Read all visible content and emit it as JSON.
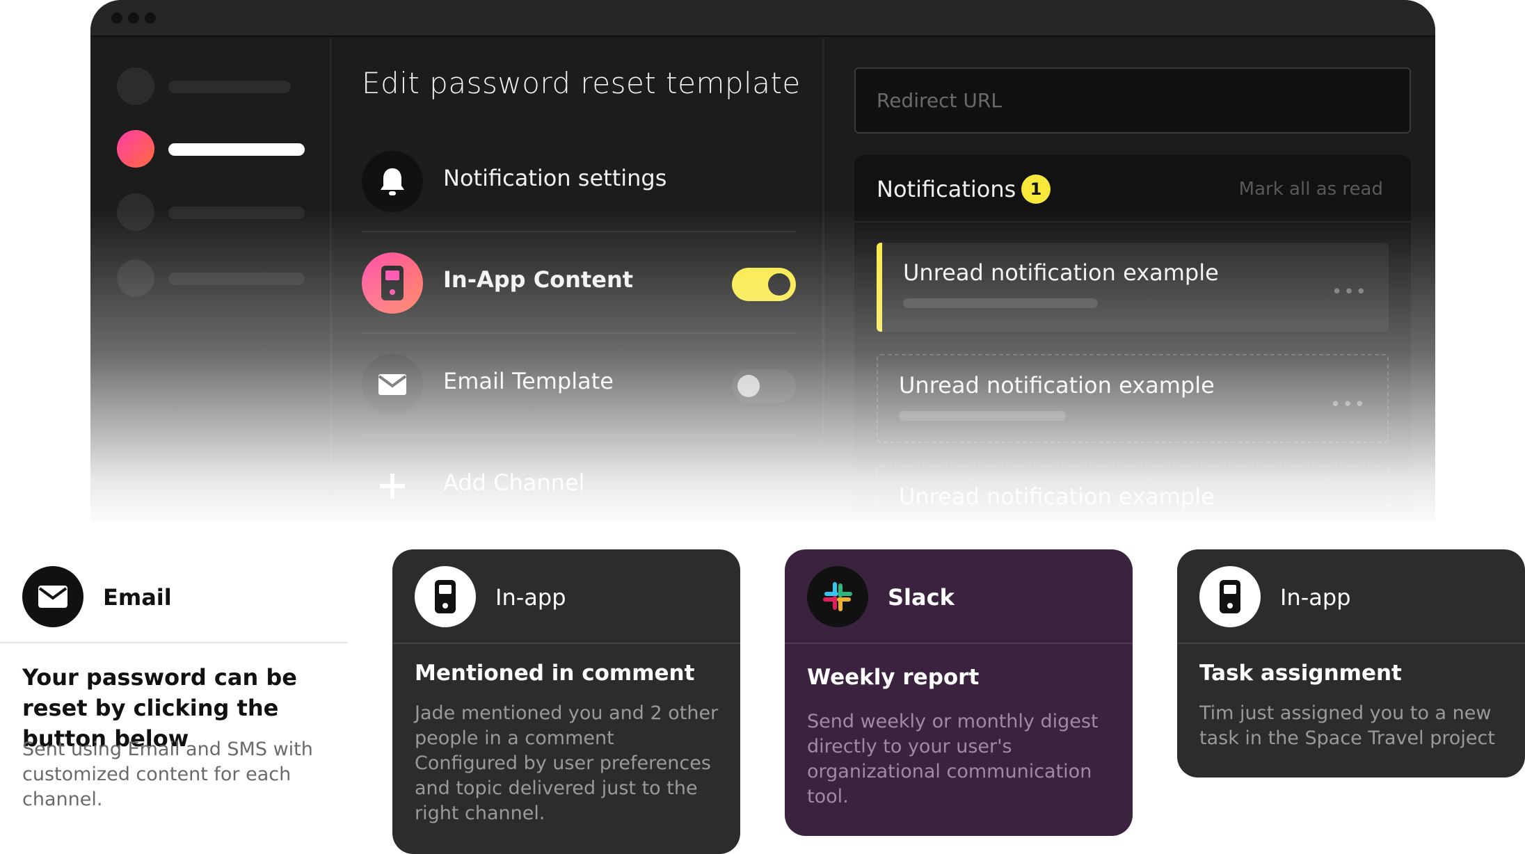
{
  "app": {
    "page_title": "Edit password reset template",
    "channels": [
      {
        "label": "Notification settings",
        "icon": "bell-icon"
      },
      {
        "label": "In-App Content",
        "icon": "phone-icon",
        "toggle": "on"
      },
      {
        "label": "Email Template",
        "icon": "envelope-icon",
        "toggle": "off"
      },
      {
        "label": "Add Channel",
        "icon": "plus-icon"
      }
    ],
    "redirect_placeholder": "Redirect URL",
    "notifications": {
      "title": "Notifications",
      "badge_count": "1",
      "mark_all": "Mark all as read",
      "items": [
        {
          "text": "Unread notification example",
          "more": "•••"
        },
        {
          "text": "Unread notification example",
          "more": "•••"
        },
        {
          "text": "Unread notification example"
        }
      ]
    }
  },
  "cards": {
    "email": {
      "label": "Email",
      "title": "Your password can be reset by clicking the button below",
      "body": "Sent using Email and SMS with customized content for each channel."
    },
    "inapp1": {
      "label": "In-app",
      "title": "Mentioned in comment",
      "body": "Jade mentioned you and 2 other people in a comment Configured by user preferences and topic delivered just to the right channel."
    },
    "slack": {
      "label": "Slack",
      "title": "Weekly report",
      "body": "Send weekly or monthly digest directly to your user's organizational communication tool."
    },
    "inapp2": {
      "label": "In-app",
      "title": "Task assignment",
      "body": "Tim just assigned you to a new task in the Space Travel project"
    }
  },
  "colors": {
    "accent_yellow": "#f9e83c",
    "gradient_pink": "#ff3ea5",
    "gradient_orange": "#ff6a3d",
    "slack_card": "#3b2340",
    "dark_card": "#2c2c2c"
  }
}
